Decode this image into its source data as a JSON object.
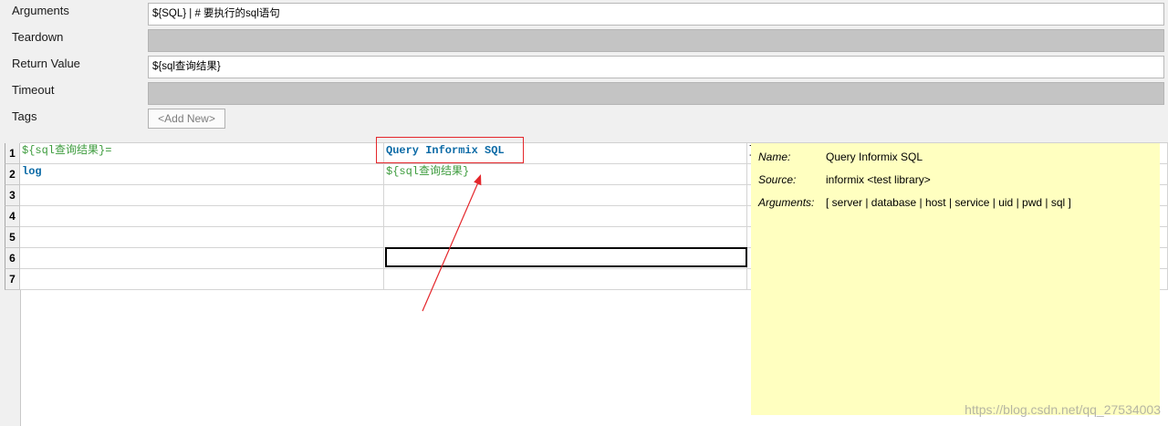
{
  "form": {
    "arguments": {
      "label": "Arguments",
      "value": "${SQL} | # 要执行的sql语句"
    },
    "teardown": {
      "label": "Teardown"
    },
    "return_value": {
      "label": "Return Value",
      "value": "${sql查询结果}"
    },
    "timeout": {
      "label": "Timeout"
    },
    "tags": {
      "label": "Tags",
      "add_new": "<Add New>"
    }
  },
  "grid": {
    "rows": [
      {
        "num": "1",
        "cells": [
          "${sql查询结果}=",
          "Query Informix SQL",
          "]"
        ]
      },
      {
        "num": "2",
        "cells": [
          "log",
          "${sql查询结果}",
          ""
        ]
      },
      {
        "num": "3",
        "cells": [
          "",
          "",
          ""
        ]
      },
      {
        "num": "4",
        "cells": [
          "",
          "",
          ""
        ]
      },
      {
        "num": "5",
        "cells": [
          "",
          "",
          ""
        ]
      },
      {
        "num": "6",
        "cells": [
          "",
          "",
          ""
        ]
      },
      {
        "num": "7",
        "cells": [
          "",
          "",
          ""
        ]
      }
    ]
  },
  "tooltip": {
    "name_label": "Name:",
    "name_value": "Query Informix SQL",
    "source_label": "Source:",
    "source_value": "informix <test library>",
    "arguments_label": "Arguments:",
    "arguments_value": "[ server | database | host | service | uid | pwd | sql ]"
  },
  "watermark": "https://blog.csdn.net/qq_27534003",
  "colors": {
    "keyword": "#0b6aa6",
    "variable": "#3c9b3c",
    "annotation": "#e4262b",
    "tooltip_background": "#ffffc0"
  }
}
